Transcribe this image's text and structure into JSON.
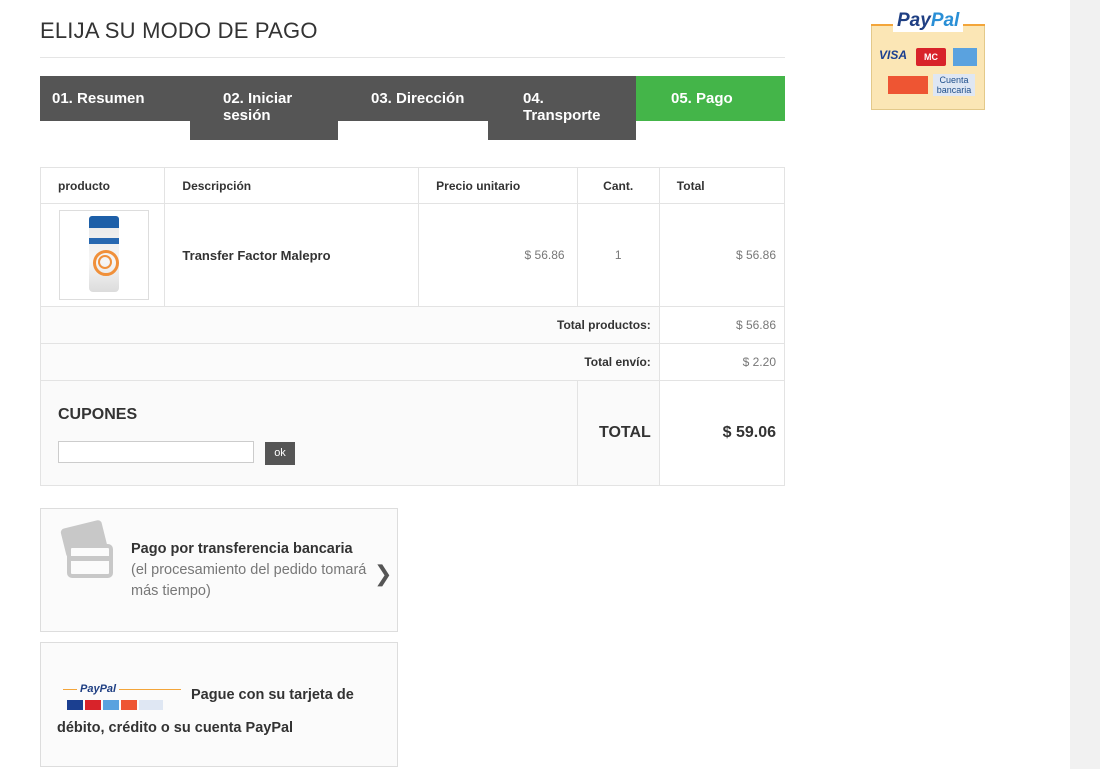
{
  "heading": "ELIJA SU MODO DE PAGO",
  "steps": [
    {
      "label": "01. Resumen",
      "active": false
    },
    {
      "label": "02. Iniciar sesión",
      "active": false
    },
    {
      "label": "03. Dirección",
      "active": false
    },
    {
      "label": "04. Transporte",
      "active": false
    },
    {
      "label": "05. Pago",
      "active": true
    }
  ],
  "cart": {
    "headers": {
      "product": "producto",
      "description": "Descripción",
      "unit_price": "Precio unitario",
      "qty": "Cant.",
      "total": "Total"
    },
    "items": [
      {
        "name": "Transfer Factor Malepro",
        "unit_price": "$ 56.86",
        "qty": "1",
        "total": "$ 56.86"
      }
    ],
    "total_products_label": "Total productos:",
    "total_products": "$ 56.86",
    "total_shipping_label": "Total envío:",
    "total_shipping": "$ 2.20",
    "grand_total_label": "TOTAL",
    "grand_total": "$ 59.06"
  },
  "coupon": {
    "title": "CUPONES",
    "input_value": "",
    "button_label": "ok"
  },
  "payment_options": {
    "bank": {
      "title": "Pago por transferencia bancaria",
      "note": " (el procesamiento del pedido tomará más tiempo)"
    },
    "paypal": {
      "line1": "Pague con su tarjeta de",
      "line2": "débito, crédito o su cuenta PayPal"
    }
  },
  "paypal_badge": {
    "logo_pay": "Pay",
    "logo_pal": "Pal",
    "visa": "VISA",
    "mastercard": "MC",
    "cuenta": "Cuenta bancaria"
  },
  "colors": {
    "step_default": "#555555",
    "step_active": "#44b549",
    "paypal_blue": "#1f3f83"
  }
}
